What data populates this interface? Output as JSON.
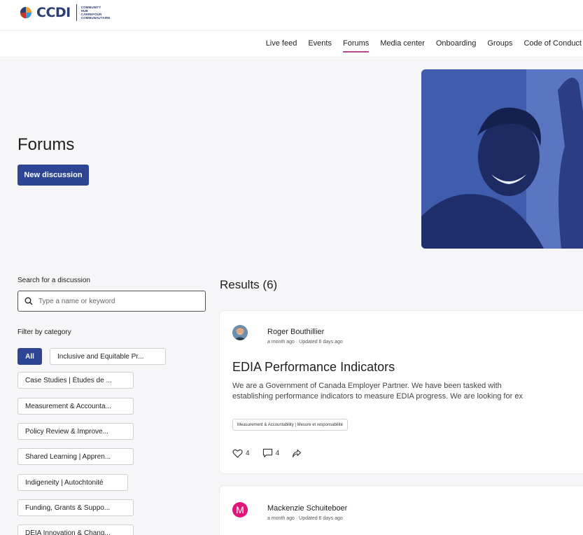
{
  "brand": {
    "name": "CCDI",
    "subtitle_lines": [
      "COMMUNITY",
      "HUB",
      "CARREFOUR",
      "COMMUNAUTAIRE"
    ]
  },
  "nav": {
    "items": [
      {
        "label": "Live feed",
        "active": false
      },
      {
        "label": "Events",
        "active": false
      },
      {
        "label": "Forums",
        "active": true
      },
      {
        "label": "Media center",
        "active": false
      },
      {
        "label": "Onboarding",
        "active": false
      },
      {
        "label": "Groups",
        "active": false
      },
      {
        "label": "Code of Conduct",
        "active": false
      }
    ]
  },
  "hero": {
    "title": "Forums",
    "new_button": "New discussion"
  },
  "sidebar": {
    "search_label": "Search for a discussion",
    "search_placeholder": "Type a name or keyword",
    "filter_label": "Filter by category",
    "categories": [
      {
        "label": "All",
        "active": true
      },
      {
        "label": "Inclusive and Equitable Pr...",
        "active": false
      },
      {
        "label": "Case Studies | Études de ...",
        "active": false
      },
      {
        "label": "Measurement & Accounta...",
        "active": false
      },
      {
        "label": "Policy Review & Improve...",
        "active": false
      },
      {
        "label": "Shared Learning | Appren...",
        "active": false
      },
      {
        "label": "Indigeneity | Autochtonité",
        "active": false
      },
      {
        "label": "Funding, Grants & Suppo...",
        "active": false
      },
      {
        "label": "DEIA Innovation & Chang...",
        "active": false
      }
    ]
  },
  "results": {
    "title": "Results (6)",
    "posts": [
      {
        "author": "Roger Bouthillier",
        "meta": "a month ago · Updated 6 days ago",
        "title": "EDIA Performance Indicators",
        "body_line1": "We are a Government of Canada Employer Partner. We have been tasked with",
        "body_line2": "establishing performance indicators to measure EDIA progress. We are looking for ex",
        "tag": "Measurement & Accountability | Mesure et responsabilité",
        "likes": "4",
        "comments": "4"
      },
      {
        "author": "Mackenzie Schuiteboer",
        "meta": "a month ago · Updated 6 days ago",
        "avatar_initial": "M"
      }
    ]
  },
  "colors": {
    "primary": "#2d4592",
    "accent_underline": "#b04d8a",
    "avatar_magenta": "#e0167a",
    "background": "#f6f5f7"
  }
}
